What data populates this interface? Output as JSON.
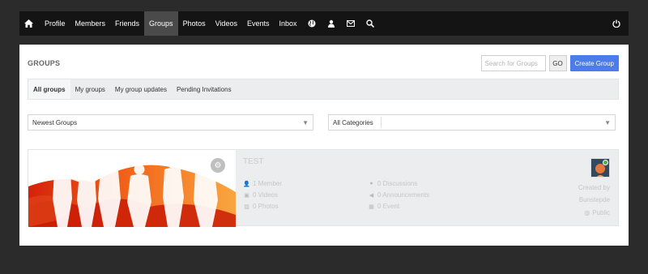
{
  "nav": {
    "home_icon": "home-icon",
    "items": [
      {
        "label": "Profile"
      },
      {
        "label": "Members"
      },
      {
        "label": "Friends"
      },
      {
        "label": "Groups",
        "active": true
      },
      {
        "label": "Photos"
      },
      {
        "label": "Videos"
      },
      {
        "label": "Events"
      },
      {
        "label": "Inbox"
      }
    ],
    "icons": [
      "globe-icon",
      "friend-request-icon",
      "mail-icon",
      "search-icon"
    ],
    "power_icon": "power-icon"
  },
  "header": {
    "title": "GROUPS",
    "search_placeholder": "Search for Groups",
    "go_label": "GO",
    "create_label": "Create Group",
    "accent": "#4b7bec"
  },
  "tabs": [
    {
      "label": "All groups",
      "active": true
    },
    {
      "label": "My groups"
    },
    {
      "label": "My group updates"
    },
    {
      "label": "Pending Invitations"
    }
  ],
  "filters": {
    "sort": "Newest Groups",
    "category": "All Categories"
  },
  "group": {
    "name": "TEST",
    "members": "1 Member",
    "videos": "0 Videos",
    "photos": "0 Photos",
    "discussions": "0 Discussions",
    "announcements": "0 Announcements",
    "events": "0 Event",
    "created_by_label": "Created by",
    "creator": "Bunstepde",
    "privacy": "Public"
  }
}
